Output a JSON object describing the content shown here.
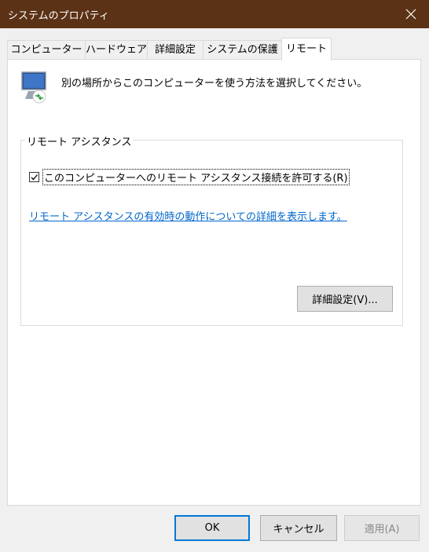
{
  "window": {
    "title": "システムのプロパティ"
  },
  "tabs": [
    {
      "label": "コンピューター名"
    },
    {
      "label": "ハードウェア"
    },
    {
      "label": "詳細設定"
    },
    {
      "label": "システムの保護"
    },
    {
      "label": "リモート"
    }
  ],
  "remote": {
    "description": "別の場所からこのコンピューターを使う方法を選択してください。",
    "assistance_group": {
      "label": "リモート アシスタンス",
      "checkbox_label": "このコンピューターへのリモート アシスタンス接続を許可する(R)",
      "checked": true,
      "link_text": "リモート アシスタンスの有効時の動作についての詳細を表示します。",
      "advanced_button": "詳細設定(V)..."
    }
  },
  "buttons": {
    "ok": "OK",
    "cancel": "キャンセル",
    "apply": "適用(A)"
  },
  "colors": {
    "titlebar": "#5c3216",
    "link": "#0066cc",
    "ok_border": "#0078d7"
  }
}
